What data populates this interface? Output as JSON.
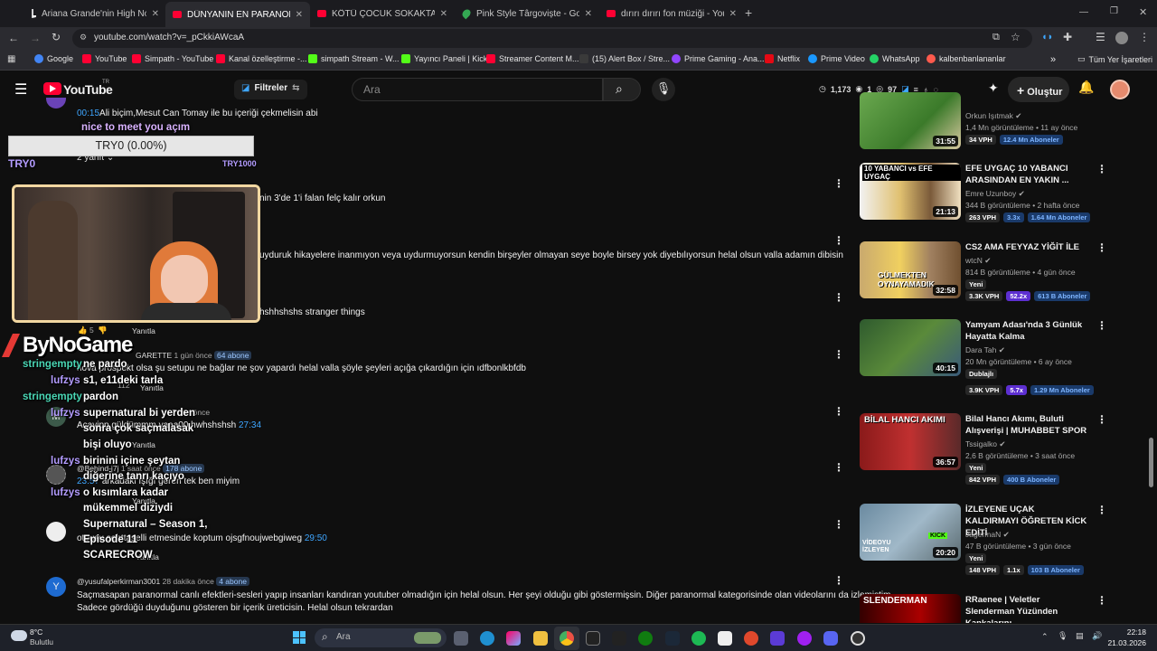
{
  "browser": {
    "tabs": [
      {
        "title": "Ariana Grande'nin High Note R"
      },
      {
        "title": "DÜNYANIN EN PARANORMAL"
      },
      {
        "title": "KÖTÜ ÇOCUK SOKAKTA VE TAK"
      },
      {
        "title": "Pink Style Târgoviște - Google"
      },
      {
        "title": "dırırı dırırı fon müziği - YouTub"
      }
    ],
    "new_tab": "+",
    "url": "youtube.com/watch?v=_pCkkiAWcaA",
    "bookmarks": [
      "Google",
      "YouTube",
      "Simpath - YouTube",
      "Kanal özelleştirme -...",
      "simpath Stream - W...",
      "Yayıncı Paneli | Kick",
      "Streamer Content M...",
      "(15) Alert Box / Stre...",
      "Prime Gaming - Ana...",
      "Netflix",
      "Prime Video",
      "WhatsApp",
      "kalbenbanlananlar"
    ],
    "bookmarks_more": "»",
    "all_bookmarks": "Tüm Yer İşaretleri"
  },
  "youtube": {
    "logo": "YouTube",
    "region": "TR",
    "filters_label": "Filtreler",
    "search_placeholder": "Ara",
    "stats": {
      "a": "1,173",
      "b": "1",
      "c": "97"
    },
    "create_label": "Oluştur"
  },
  "overlay": {
    "goal_label": "TRY0 (0.00%)",
    "goal_left": "TRY0",
    "goal_right": "TRY1000",
    "streamer_logo": "ByNoGame",
    "chat": [
      {
        "name": "stringempty",
        "msg": "ne pardo"
      },
      {
        "name": "lufzys",
        "msg": "s1, e11deki tarla"
      },
      {
        "name": "stringempty",
        "msg": "pardon"
      },
      {
        "name": "lufzys",
        "msg": "supernatural bi yerden"
      },
      {
        "name": "",
        "msg": "sonra çok saçmalasak"
      },
      {
        "name": "",
        "msg": "bişi oluyo"
      },
      {
        "name": "lufzys",
        "msg": "birinini içine şeytan"
      },
      {
        "name": "",
        "msg": "diğerine tanrı kaçıyo"
      },
      {
        "name": "lufzys",
        "msg": "o kısımlara kadar"
      },
      {
        "name": "",
        "msg": "mükemmel diziydi"
      },
      {
        "name": "",
        "msg": "Supernatural – Season 1,"
      },
      {
        "name": "",
        "msg": "Episode 11"
      },
      {
        "name": "",
        "msg": "SCARECROW"
      }
    ]
  },
  "comments": [
    {
      "ts": "00:15",
      "text": "Ali biçim,Mesut Can Tomay ile bu içeriği çekmelisin abi"
    },
    {
      "text": "nice to meet you açım"
    },
    {
      "replies": "2 yanıt"
    },
    {
      "text": "nin 3'de 1'i falan felç kalır orkun"
    },
    {
      "text": "uyduruk hikayelere inanmıyon veya uydurmuyorsun kendin birşeyler olmayan seye boyle birsey yok diyebılıyorsun helal olsun valla adamın dibisin"
    },
    {
      "text": "hshhshshs stranger things",
      "likes": "5",
      "reply": "Yanıtla"
    },
    {
      "author": "GARETTE",
      "time": "1 gün önce",
      "badge": "64 abone",
      "text": "nova prospekt olsa şu setupu ne bağlar ne şov yapardı helal valla şöyle şeyleri açığa çıkardığın için ıdfbonlkbfdb",
      "likes": "112",
      "reply": "Yanıtla"
    },
    {
      "time": "7 gün önce",
      "text": "Acayipp güldümmm yaaa00 hwhshshsh",
      "ts": "27:34",
      "reply": "Yanıtla"
    },
    {
      "author": "@Behind-j7j",
      "time": "1 saat önce",
      "badge": "178 abone",
      "ts": "23:57",
      "text": "arkadaki ışığı gören tek ben miyim",
      "likes": "5",
      "reply": "Yanıtla"
    },
    {
      "text": "otpusu sehttaselli etmesinde koptum ojsgfnoujwebgiweg",
      "ts": "29:50",
      "reply": "Yanıtla"
    },
    {
      "author": "@yusufalperkirman3001",
      "time": "28 dakika önce",
      "badge": "4 abone",
      "text": "Saçmasapan paranormal canlı efektleri-sesleri yapıp insanları kandıran youtuber olmadığın için helal olsun. Her şeyi olduğu gibi göstermişsin. Diğer paranormal kategorisinde olan videolarını da izlemiştim.",
      "text2": "Sadece gördüğü duyduğunu gösteren bir içerik üreticisin. Helal olsun tekrardan"
    }
  ],
  "related": [
    {
      "title": "",
      "channel": "Orkun Işıtmak",
      "meta": "1,4 Mn görüntüleme • 11 ay önce",
      "duration": "31:55",
      "vph": "34 VPH",
      "mult": "",
      "subs": "12.4 Mn Aboneler"
    },
    {
      "title": "EFE UYGAÇ 10 YABANCI ARASINDAN EN YAKIN ...",
      "thumb_text": "10 YABANCI vs EFE UYGAÇ",
      "channel": "Emre Uzunboy",
      "meta": "344 B görüntüleme • 2 hafta önce",
      "duration": "21:13",
      "vph": "263 VPH",
      "mult": "3.3x",
      "subs": "1.64 Mn Aboneler"
    },
    {
      "title": "CS2 AMA FEYYAZ YİĞİT İLE",
      "thumb_text": "GÜLMEKTEN OYNAYAMADIK",
      "channel": "wtcN",
      "meta": "814 B görüntüleme • 4 gün önce",
      "tag": "Yeni",
      "duration": "32:58",
      "vph": "3.3K VPH",
      "mult": "52.2x",
      "subs": "613 B Aboneler"
    },
    {
      "title": "Yamyam Adası'nda 3 Günlük Hayatta Kalma",
      "channel": "Dara Tah",
      "meta": "20 Mn görüntüleme • 6 ay önce",
      "tag": "Dublajlı",
      "duration": "40:15",
      "vph": "3.9K VPH",
      "mult": "5.7x",
      "subs": "1.29 Mn Aboneler"
    },
    {
      "title": "Bilal Hancı Akımı, Buluti Alışverişi | MUHABBET SPOR",
      "thumb_text": "BİLAL HANCI AKIMI",
      "channel": "Tssigalko",
      "meta": "2,6 B görüntüleme • 3 saat önce",
      "tag": "Yeni",
      "duration": "36:57",
      "vph": "842 VPH",
      "mult": "",
      "subs": "400 B Aboneler"
    },
    {
      "title": "İZLEYENE UÇAK KALDIRMAYI ÖĞRETEN KİCK EDİTİ",
      "thumb_text": "VİDEOYU İZLEYEN",
      "channel": "JagermaN",
      "meta": "47 B görüntüleme • 3 gün önce",
      "tag": "Yeni",
      "duration": "20:20",
      "vph": "148 VPH",
      "mult": "1.1x",
      "subs": "103 B Aboneler"
    },
    {
      "title": "RRaenee | Veletler Slenderman Yüzünden Kankalarını ...",
      "thumb_text": "SLENDERMAN",
      "channel": "",
      "meta": "",
      "duration": "",
      "vph": "",
      "mult": "",
      "subs": ""
    }
  ],
  "taskbar": {
    "weather_temp": "8°C",
    "weather_desc": "Bulutlu",
    "search_placeholder": "Ara",
    "time": "22:18",
    "date": "21.03.2026"
  },
  "colors": {
    "yt_red": "#ff0033",
    "link_blue": "#3ea6ff",
    "chat_purple": "#b39cff",
    "chat_green": "#4ad7b5"
  }
}
